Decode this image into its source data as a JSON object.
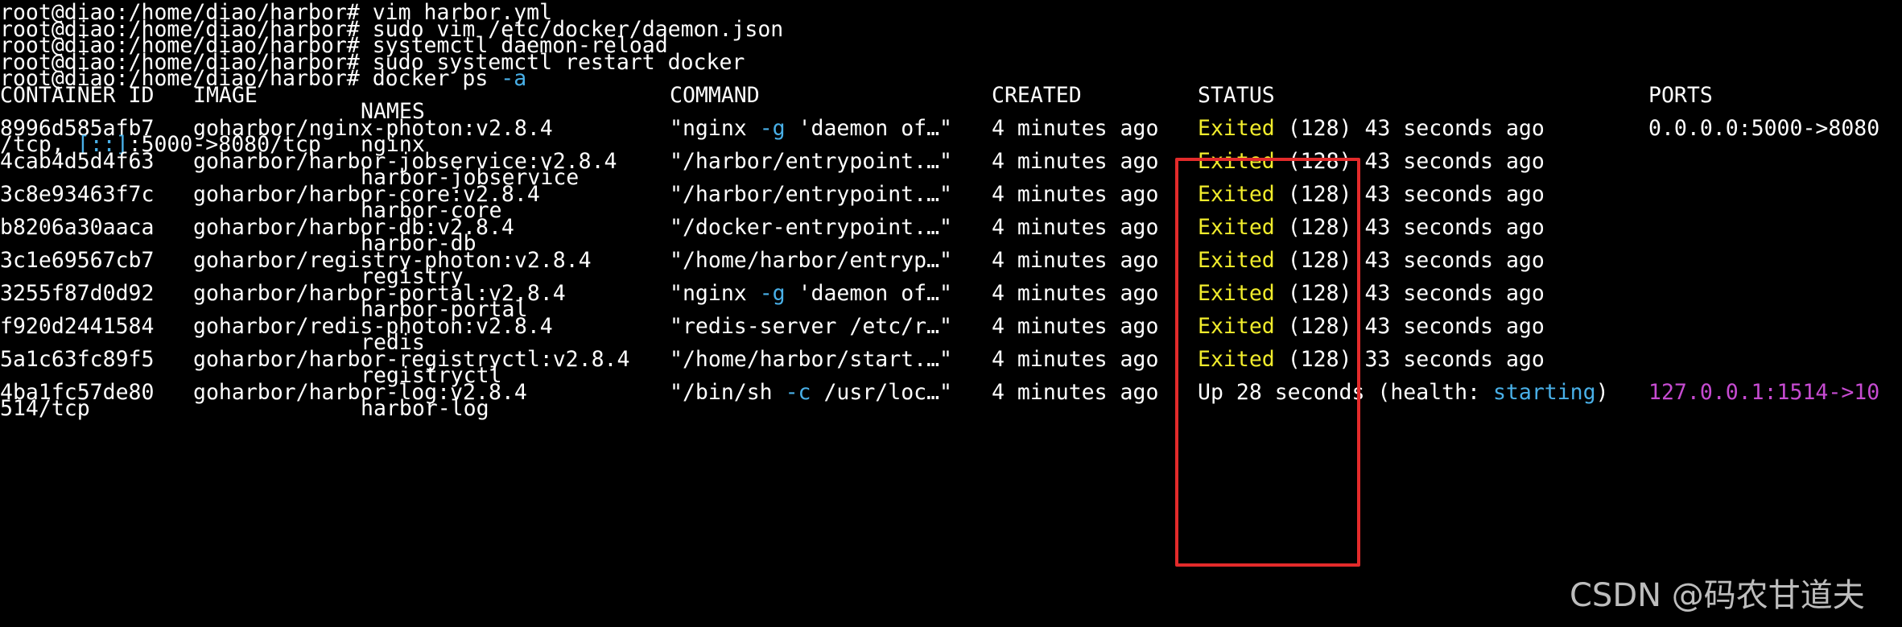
{
  "terminal": {
    "prompt": "root@diao:/home/diao/harbor#",
    "commands": [
      "vim harbor.yml",
      "sudo vim /etc/docker/daemon.json",
      "systemctl daemon-reload",
      "sudo systemctl restart docker"
    ],
    "last_command": {
      "base": "docker ps",
      "flag": "-a"
    },
    "headers": {
      "container_id": "CONTAINER ID",
      "image": "IMAGE",
      "command": "COMMAND",
      "created": "CREATED",
      "status": "STATUS",
      "ports": "PORTS",
      "names": "NAMES"
    },
    "rows": [
      {
        "id": "8996d585afb7",
        "image": "goharbor/nginx-photon:v2.8.4",
        "command": {
          "pre": "\"nginx ",
          "flag": "-g",
          "post": " 'daemon of…\""
        },
        "created": "4 minutes ago",
        "status_word": "Exited",
        "status_code": "(128)",
        "status_time": "43 seconds ago",
        "ports": "0.0.0.0:5000->8080",
        "ports_cont": {
          "pre": "/tcp, ",
          "ipv6": "[::]",
          "post": ":5000->8080/tcp"
        },
        "name": "nginx"
      },
      {
        "id": "4cab4d5d4f63",
        "image": "goharbor/harbor-jobservice:v2.8.4",
        "command": {
          "pre": "\"/harbor/entrypoint.…\"",
          "flag": "",
          "post": ""
        },
        "created": "4 minutes ago",
        "status_word": "Exited",
        "status_code": "(128)",
        "status_time": "43 seconds ago",
        "name": "harbor-jobservice"
      },
      {
        "id": "3c8e93463f7c",
        "image": "goharbor/harbor-core:v2.8.4",
        "command": {
          "pre": "\"/harbor/entrypoint.…\"",
          "flag": "",
          "post": ""
        },
        "created": "4 minutes ago",
        "status_word": "Exited",
        "status_code": "(128)",
        "status_time": "43 seconds ago",
        "name": "harbor-core"
      },
      {
        "id": "b8206a30aaca",
        "image": "goharbor/harbor-db:v2.8.4",
        "command": {
          "pre": "\"/docker-entrypoint.…\"",
          "flag": "",
          "post": ""
        },
        "created": "4 minutes ago",
        "status_word": "Exited",
        "status_code": "(128)",
        "status_time": "43 seconds ago",
        "name": "harbor-db"
      },
      {
        "id": "3c1e69567cb7",
        "image": "goharbor/registry-photon:v2.8.4",
        "command": {
          "pre": "\"/home/harbor/entryp…\"",
          "flag": "",
          "post": ""
        },
        "created": "4 minutes ago",
        "status_word": "Exited",
        "status_code": "(128)",
        "status_time": "43 seconds ago",
        "name": "registry"
      },
      {
        "id": "3255f87d0d92",
        "image": "goharbor/harbor-portal:v2.8.4",
        "command": {
          "pre": "\"nginx ",
          "flag": "-g",
          "post": " 'daemon of…\""
        },
        "created": "4 minutes ago",
        "status_word": "Exited",
        "status_code": "(128)",
        "status_time": "43 seconds ago",
        "name": "harbor-portal"
      },
      {
        "id": "f920d2441584",
        "image": "goharbor/redis-photon:v2.8.4",
        "command": {
          "pre": "\"redis-server /etc/r…\"",
          "flag": "",
          "post": ""
        },
        "created": "4 minutes ago",
        "status_word": "Exited",
        "status_code": "(128)",
        "status_time": "43 seconds ago",
        "name": "redis"
      },
      {
        "id": "5a1c63fc89f5",
        "image": "goharbor/harbor-registryctl:v2.8.4",
        "command": {
          "pre": "\"/home/harbor/start.…\"",
          "flag": "",
          "post": ""
        },
        "created": "4 minutes ago",
        "status_word": "Exited",
        "status_code": "(128)",
        "status_time": "33 seconds ago",
        "name": "registryctl"
      },
      {
        "id": "4ba1fc57de80",
        "image": "goharbor/harbor-log:v2.8.4",
        "command": {
          "pre": "\"/bin/sh ",
          "flag": "-c",
          "post": " /usr/loc…\""
        },
        "created": "4 minutes ago",
        "status_pre": "Up 28 seconds (health: ",
        "status_health": "starting",
        "status_post": ")",
        "ports": "127.0.0.1:1514->10",
        "ports_cont": {
          "pre": "514/tcp",
          "ipv6": "",
          "post": ""
        },
        "name": "harbor-log"
      }
    ]
  },
  "watermark": "CSDN @码农甘道夫",
  "colors": {
    "background": "#000000",
    "text": "#ffffff",
    "status_exited": "#f1ec2c",
    "flag": "#49b0e8",
    "highlight_box": "#e32b2b",
    "ports_faded": "#c64bd1"
  }
}
